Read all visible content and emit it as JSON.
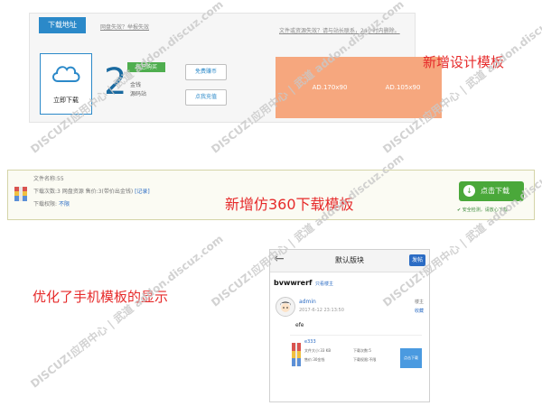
{
  "panel1": {
    "tab": "下载地址",
    "link_left": "网盘失效？举报失效",
    "notice": "文件或资源失效？请与站长联系，24小时内删除。",
    "download_button": "立即下载",
    "count": "2",
    "badge": "您已购买",
    "price_label": "金钱",
    "source_label": "源码站",
    "btn_free": "免费赚币",
    "btn_recharge": "点我充值",
    "ad1": "AD.170x90",
    "ad2": "AD.105x90",
    "caption": "新增设计模板"
  },
  "panel2": {
    "line1": "文件名称:55",
    "line2_prefix": "下载次数:3   网盘资源   售价:3(带价出金钱) ",
    "line2_tag": "[记录]",
    "line3_prefix": "下载权限: ",
    "line3_tag": "不限",
    "caption": "新增仿360下载模板",
    "button": "点击下载",
    "safe_text": "安全检测，请放心下载"
  },
  "caption3": "优化了手机模板的显示",
  "phone": {
    "back": "←",
    "title": "默认版块",
    "header_button": "发帖",
    "post_title": "bvwwrerf",
    "moderator": "只看楼主",
    "user": "admin",
    "date": "2017-6-12 23:13:50",
    "floor": "楼主",
    "fav": "收藏",
    "body": "efe",
    "file_name": "e333",
    "file_size": "文件大小:33 KB",
    "file_price": "售价:30金钱",
    "file_downloads": "下载次数:5",
    "file_perm": "下载权限:不限",
    "download_button": "点击下载"
  },
  "watermark": "DISCUZ!应用中心 | 武道 addon.discuz.com",
  "colors": {
    "accent_blue": "#2b89c9",
    "ad_orange": "#f6a77e",
    "caption_red": "#e62a2a",
    "download_green": "#4aa83a"
  }
}
